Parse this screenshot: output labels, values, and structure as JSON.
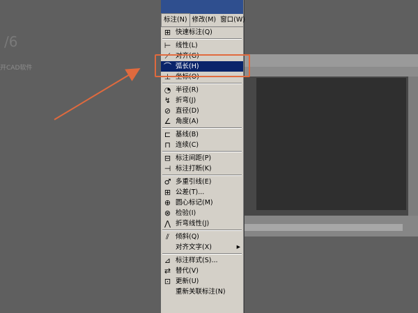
{
  "background": {
    "left_number": "/6",
    "left_text": "开CAD软件"
  },
  "menubar": {
    "items": [
      "标注(N)",
      "修改(M)",
      "窗口(W)"
    ]
  },
  "menu": {
    "groups": [
      [
        {
          "label": "快速标注(Q)",
          "icon": "quick-dimension-icon"
        }
      ],
      [
        {
          "label": "线性(L)",
          "icon": "linear-icon"
        },
        {
          "label": "对齐(G)",
          "icon": "aligned-icon"
        },
        {
          "label": "弧长(H)",
          "icon": "arc-length-icon",
          "selected": true
        },
        {
          "label": "坐标(O)",
          "icon": "ordinate-icon"
        }
      ],
      [
        {
          "label": "半径(R)",
          "icon": "radius-icon"
        },
        {
          "label": "折弯(J)",
          "icon": "jogged-icon"
        },
        {
          "label": "直径(D)",
          "icon": "diameter-icon"
        },
        {
          "label": "角度(A)",
          "icon": "angular-icon"
        }
      ],
      [
        {
          "label": "基线(B)",
          "icon": "baseline-icon"
        },
        {
          "label": "连续(C)",
          "icon": "continue-icon"
        }
      ],
      [
        {
          "label": "标注间距(P)",
          "icon": "dim-space-icon"
        },
        {
          "label": "标注打断(K)",
          "icon": "dim-break-icon"
        }
      ],
      [
        {
          "label": "多重引线(E)",
          "icon": "multileader-icon"
        },
        {
          "label": "公差(T)...",
          "icon": "tolerance-icon"
        },
        {
          "label": "圆心标记(M)",
          "icon": "center-mark-icon"
        },
        {
          "label": "检验(I)",
          "icon": "inspection-icon"
        },
        {
          "label": "折弯线性(J)",
          "icon": "jogged-linear-icon"
        }
      ],
      [
        {
          "label": "倾斜(Q)",
          "icon": "oblique-icon"
        },
        {
          "label": "对齐文字(X)",
          "icon": "",
          "submenu": true
        }
      ],
      [
        {
          "label": "标注样式(S)...",
          "icon": "dim-style-icon"
        },
        {
          "label": "替代(V)",
          "icon": "override-icon"
        },
        {
          "label": "更新(U)",
          "icon": "update-icon"
        },
        {
          "label": "重新关联标注(N)",
          "icon": ""
        }
      ]
    ]
  },
  "colors": {
    "menu_bg": "#d4d0c8",
    "selected_bg": "#0a246a",
    "highlight_box": "#e06a3e",
    "arrow": "#e06a3e"
  }
}
